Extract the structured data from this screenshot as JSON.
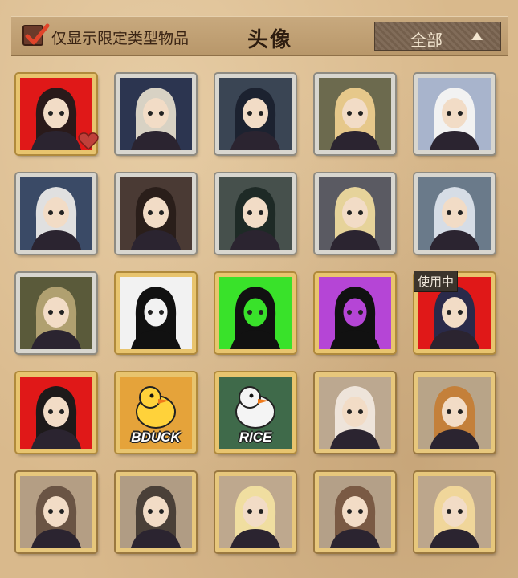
{
  "header": {
    "filter_checked": true,
    "filter_label": "仅显示限定类型物品",
    "title": "头像",
    "dropdown_value": "全部"
  },
  "grid": {
    "in_use_label": "使用中",
    "items": [
      {
        "bg": "#e01818",
        "frame": "gold",
        "icon": "portrait-red-glasses-woman-icon",
        "accent": "#2a1a1a"
      },
      {
        "bg": "#2c3550",
        "frame": "silver",
        "icon": "portrait-bearded-man-icon",
        "accent": "#d8d2c4"
      },
      {
        "bg": "#3a4554",
        "frame": "silver",
        "icon": "portrait-plague-doctor-icon",
        "accent": "#1c2230"
      },
      {
        "bg": "#6c6a4e",
        "frame": "silver",
        "icon": "portrait-blond-boy-glasses-icon",
        "accent": "#e6c88a"
      },
      {
        "bg": "#a8b4cc",
        "frame": "silver",
        "icon": "portrait-white-hair-girl-icon",
        "accent": "#f2f2f2"
      },
      {
        "bg": "#3a4a66",
        "frame": "silver",
        "icon": "portrait-masked-pair-icon",
        "accent": "#e0e0e0"
      },
      {
        "bg": "#4a3a34",
        "frame": "silver",
        "icon": "portrait-red-flower-girl-icon",
        "accent": "#2a1e1a"
      },
      {
        "bg": "#46504c",
        "frame": "silver",
        "icon": "portrait-green-hair-ghost-icon",
        "accent": "#1e2a26"
      },
      {
        "bg": "#5a5a62",
        "frame": "silver",
        "icon": "portrait-blindfold-blond-icon",
        "accent": "#e6d39a"
      },
      {
        "bg": "#6a7a8a",
        "frame": "silver",
        "icon": "portrait-grey-curls-icon",
        "accent": "#d6dde6"
      },
      {
        "bg": "#5a5a3a",
        "frame": "silver",
        "icon": "portrait-clockwork-icon",
        "accent": "#b0a070"
      },
      {
        "bg": "#f2f2f2",
        "frame": "gold",
        "icon": "silhouette-joker-icon",
        "accent": "#111111"
      },
      {
        "bg": "#39e22a",
        "frame": "gold",
        "icon": "silhouette-girl-glasses-icon",
        "accent": "#111111"
      },
      {
        "bg": "#b545d6",
        "frame": "gold",
        "icon": "silhouette-hat-man-icon",
        "accent": "#111111"
      },
      {
        "bg": "#e01818",
        "frame": "gold",
        "icon": "portrait-dark-hair-man-icon",
        "accent": "#2a2a4a",
        "in_use": true
      },
      {
        "bg": "#e01818",
        "frame": "gold",
        "icon": "portrait-witch-hat-woman-icon",
        "accent": "#1e1a1a"
      },
      {
        "bg": "#e5a33a",
        "frame": "gold",
        "icon": "duck-bduck-icon",
        "accent": "#ffd23a",
        "caption": "BDUCK"
      },
      {
        "bg": "#3f6a4a",
        "frame": "gold",
        "icon": "duck-rice-icon",
        "accent": "#f4f4f4",
        "caption": "RICE"
      },
      {
        "bg": "#bca890",
        "frame": "brown",
        "icon": "portrait-pale-doll-icon",
        "accent": "#eee4da"
      },
      {
        "bg": "#b8a488",
        "frame": "brown",
        "icon": "portrait-braided-girl-icon",
        "accent": "#c4803a"
      },
      {
        "bg": "#b49e84",
        "frame": "brown",
        "icon": "portrait-diver-helmet-icon",
        "accent": "#6a5444"
      },
      {
        "bg": "#b09c84",
        "frame": "brown",
        "icon": "portrait-goggles-hood-icon",
        "accent": "#4a4038"
      },
      {
        "bg": "#bea88e",
        "frame": "brown",
        "icon": "portrait-blond-twin-tails-icon",
        "accent": "#f0dea0"
      },
      {
        "bg": "#b4a088",
        "frame": "brown",
        "icon": "portrait-brown-hair-goggles-icon",
        "accent": "#7a5a44"
      },
      {
        "bg": "#bca68c",
        "frame": "brown",
        "icon": "portrait-blond-girl-goggles-icon",
        "accent": "#f0d69a"
      }
    ]
  }
}
